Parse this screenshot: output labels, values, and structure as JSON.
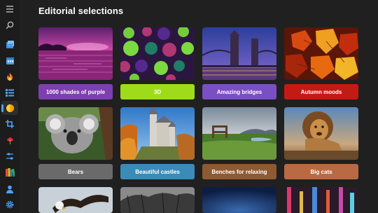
{
  "page": {
    "title": "Editorial selections"
  },
  "sidebar": {
    "icons": [
      "menu-icon",
      "search-icon",
      "photo-collection-icon",
      "calendar-icon",
      "trending-icon",
      "list-icon",
      "sticker-icon",
      "crop-icon",
      "flower-icon",
      "settings-sliders-icon",
      "library-icon",
      "person-icon",
      "gear-icon"
    ],
    "active_index": 6
  },
  "rows": [
    [
      {
        "label": "1000 shades of purple",
        "color": "#7e3fb0"
      },
      {
        "label": "3D",
        "color": "#9edc1a"
      },
      {
        "label": "Amazing bridges",
        "color": "#7a4fc3"
      },
      {
        "label": "Autumn moods",
        "color": "#c41a14"
      }
    ],
    [
      {
        "label": "Bears",
        "color": "#6a6a6a"
      },
      {
        "label": "Beautiful castles",
        "color": "#3a8bb8"
      },
      {
        "label": "Benches for relaxing",
        "color": "#8e5a32"
      },
      {
        "label": "Big cats",
        "color": "#b96a42"
      }
    ]
  ],
  "colors": {
    "accent": "#4aa3ff",
    "background": "#202020"
  }
}
